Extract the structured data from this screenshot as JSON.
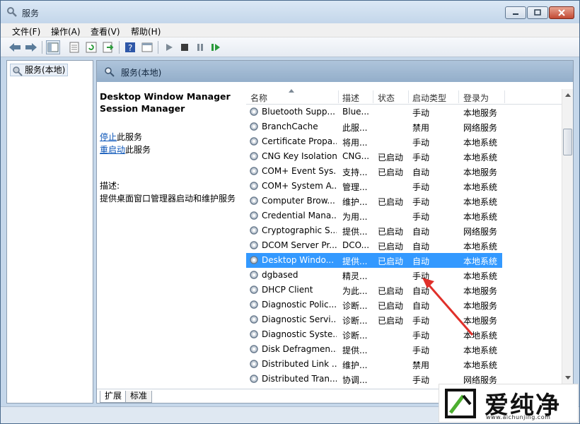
{
  "window": {
    "title": "服务",
    "icon": "gear-search-icon"
  },
  "menu": [
    "文件(F)",
    "操作(A)",
    "查看(V)",
    "帮助(H)"
  ],
  "tree": {
    "item": "服务(本地)"
  },
  "pane": {
    "header": "服务(本地)",
    "selected_title_line1": "Desktop Window Manager",
    "selected_title_line2": "Session Manager",
    "stop_link": "停止",
    "stop_suffix": "此服务",
    "restart_link": "重启动",
    "restart_suffix": "此服务",
    "desc_label": "描述:",
    "desc_text": "提供桌面窗口管理器启动和维护服务"
  },
  "columns": [
    "名称",
    "描述",
    "状态",
    "启动类型",
    "登录为"
  ],
  "rows": [
    {
      "name": "Bluetooth Supp...",
      "desc": "Blue...",
      "state": "",
      "start": "手动",
      "logon": "本地服务"
    },
    {
      "name": "BranchCache",
      "desc": "此服...",
      "state": "",
      "start": "禁用",
      "logon": "网络服务"
    },
    {
      "name": "Certificate Propa...",
      "desc": "将用...",
      "state": "",
      "start": "手动",
      "logon": "本地系统"
    },
    {
      "name": "CNG Key Isolation",
      "desc": "CNG...",
      "state": "已启动",
      "start": "手动",
      "logon": "本地系统"
    },
    {
      "name": "COM+ Event Sys...",
      "desc": "支持...",
      "state": "已启动",
      "start": "自动",
      "logon": "本地服务"
    },
    {
      "name": "COM+ System A...",
      "desc": "管理...",
      "state": "",
      "start": "手动",
      "logon": "本地系统"
    },
    {
      "name": "Computer Brow...",
      "desc": "维护...",
      "state": "已启动",
      "start": "手动",
      "logon": "本地系统"
    },
    {
      "name": "Credential Mana...",
      "desc": "为用...",
      "state": "",
      "start": "手动",
      "logon": "本地系统"
    },
    {
      "name": "Cryptographic S...",
      "desc": "提供...",
      "state": "已启动",
      "start": "自动",
      "logon": "网络服务"
    },
    {
      "name": "DCOM Server Pr...",
      "desc": "DCO...",
      "state": "已启动",
      "start": "自动",
      "logon": "本地系统"
    },
    {
      "name": "Desktop Windo...",
      "desc": "提供...",
      "state": "已启动",
      "start": "自动",
      "logon": "本地系统",
      "selected": true
    },
    {
      "name": "dgbased",
      "desc": "精灵...",
      "state": "",
      "start": "手动",
      "logon": "本地系统"
    },
    {
      "name": "DHCP Client",
      "desc": "为此...",
      "state": "已启动",
      "start": "自动",
      "logon": "本地服务"
    },
    {
      "name": "Diagnostic Polic...",
      "desc": "诊断...",
      "state": "已启动",
      "start": "自动",
      "logon": "本地服务"
    },
    {
      "name": "Diagnostic Servi...",
      "desc": "诊断...",
      "state": "已启动",
      "start": "手动",
      "logon": "本地服务"
    },
    {
      "name": "Diagnostic Syste...",
      "desc": "诊断...",
      "state": "",
      "start": "手动",
      "logon": "本地系统"
    },
    {
      "name": "Disk Defragmen...",
      "desc": "提供...",
      "state": "",
      "start": "手动",
      "logon": "本地系统"
    },
    {
      "name": "Distributed Link ...",
      "desc": "维护...",
      "state": "",
      "start": "禁用",
      "logon": "本地系统"
    },
    {
      "name": "Distributed Tran...",
      "desc": "协调...",
      "state": "",
      "start": "手动",
      "logon": "网络服务"
    }
  ],
  "tabs": [
    "扩展",
    "标准"
  ],
  "watermark": {
    "brand": "爱纯净",
    "url": "www.aichunjing.com"
  },
  "colors": {
    "selection": "#3399ff",
    "annotation_arrow": "#e0302a"
  }
}
